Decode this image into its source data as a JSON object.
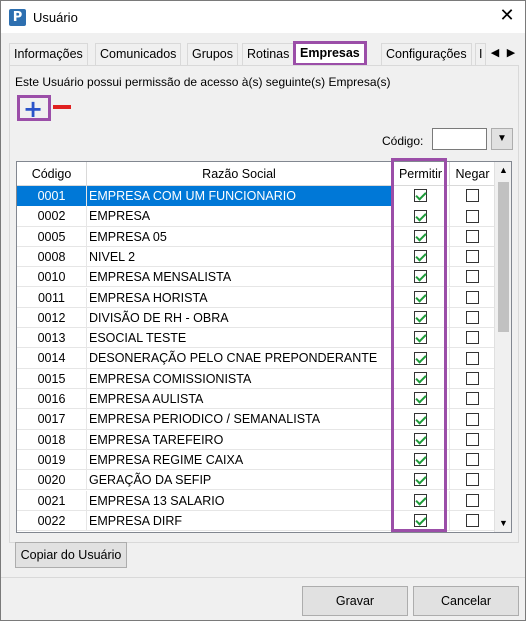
{
  "window": {
    "title": "Usuário",
    "close_glyph": "✕",
    "app_icon": "P"
  },
  "tabs": [
    {
      "label": "Informações",
      "active": false
    },
    {
      "label": "Comunicados",
      "active": false
    },
    {
      "label": "Grupos",
      "active": false
    },
    {
      "label": "Rotinas",
      "active": false
    },
    {
      "label": "Empresas",
      "active": true
    },
    {
      "label": "Configurações",
      "active": false
    },
    {
      "label": "I",
      "active": false
    }
  ],
  "tab_scroll": {
    "left": "◀",
    "right": "▶"
  },
  "permission_text": "Este Usuário possui permissão de acesso à(s) seguinte(s) Empresa(s)",
  "toolbar": {
    "add_glyph": "+",
    "remove_glyph": "−"
  },
  "code_filter": {
    "label": "Código:",
    "value": "",
    "dropdown_glyph": "▼"
  },
  "grid": {
    "columns": [
      "Código",
      "Razão Social",
      "Permitir",
      "Negar"
    ],
    "rows": [
      {
        "code": "0001",
        "name": "EMPRESA COM UM FUNCIONARIO",
        "permitir": true,
        "negar": false,
        "selected": true
      },
      {
        "code": "0002",
        "name": "EMPRESA",
        "permitir": true,
        "negar": false
      },
      {
        "code": "0005",
        "name": "EMPRESA 05",
        "permitir": true,
        "negar": false
      },
      {
        "code": "0008",
        "name": "NIVEL 2",
        "permitir": true,
        "negar": false
      },
      {
        "code": "0010",
        "name": "EMPRESA MENSALISTA",
        "permitir": true,
        "negar": false
      },
      {
        "code": "0011",
        "name": "EMPRESA HORISTA",
        "permitir": true,
        "negar": false
      },
      {
        "code": "0012",
        "name": "DIVISÃO DE RH - OBRA",
        "permitir": true,
        "negar": false
      },
      {
        "code": "0013",
        "name": "ESOCIAL TESTE",
        "permitir": true,
        "negar": false
      },
      {
        "code": "0014",
        "name": "DESONERAÇÃO PELO CNAE PREPONDERANTE",
        "permitir": true,
        "negar": false
      },
      {
        "code": "0015",
        "name": "EMPRESA COMISSIONISTA",
        "permitir": true,
        "negar": false
      },
      {
        "code": "0016",
        "name": "EMPRESA AULISTA",
        "permitir": true,
        "negar": false
      },
      {
        "code": "0017",
        "name": "EMPRESA PERIODICO / SEMANALISTA",
        "permitir": true,
        "negar": false
      },
      {
        "code": "0018",
        "name": "EMPRESA TAREFEIRO",
        "permitir": true,
        "negar": false
      },
      {
        "code": "0019",
        "name": "EMPRESA REGIME CAIXA",
        "permitir": true,
        "negar": false
      },
      {
        "code": "0020",
        "name": "GERAÇÃO DA SEFIP",
        "permitir": true,
        "negar": false
      },
      {
        "code": "0021",
        "name": "EMPRESA 13 SALARIO",
        "permitir": true,
        "negar": false
      },
      {
        "code": "0022",
        "name": "EMPRESA DIRF",
        "permitir": true,
        "negar": false
      }
    ]
  },
  "scrollbar": {
    "up": "▲",
    "down": "▼"
  },
  "buttons": {
    "copy": "Copiar do Usuário",
    "save": "Gravar",
    "cancel": "Cancelar"
  },
  "colors": {
    "highlight": "#9b4ea8",
    "selection": "#0078d7",
    "check": "#1e9b3a",
    "add": "#2a53c9",
    "remove": "#e02020"
  }
}
